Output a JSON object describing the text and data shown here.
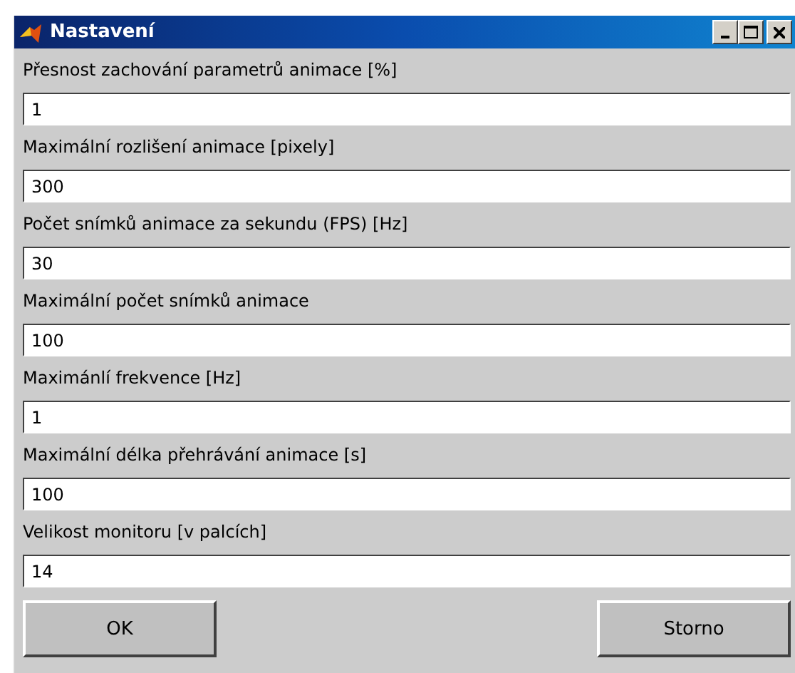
{
  "window": {
    "title": "Nastavení"
  },
  "fields": [
    {
      "label": "Přesnost zachování parametrů animace [%]",
      "value": "1"
    },
    {
      "label": "Maximální rozlišení animace [pixely]",
      "value": "300"
    },
    {
      "label": "Počet snímků animace za sekundu (FPS) [Hz]",
      "value": "30"
    },
    {
      "label": "Maximální počet snímků animace",
      "value": "100"
    },
    {
      "label": "Maximánlí frekvence [Hz]",
      "value": "1"
    },
    {
      "label": "Maximální délka přehrávání animace [s]",
      "value": "100"
    },
    {
      "label": "Velikost monitoru [v palcích]",
      "value": "14"
    }
  ],
  "buttons": [
    "OK",
    "Storno"
  ]
}
